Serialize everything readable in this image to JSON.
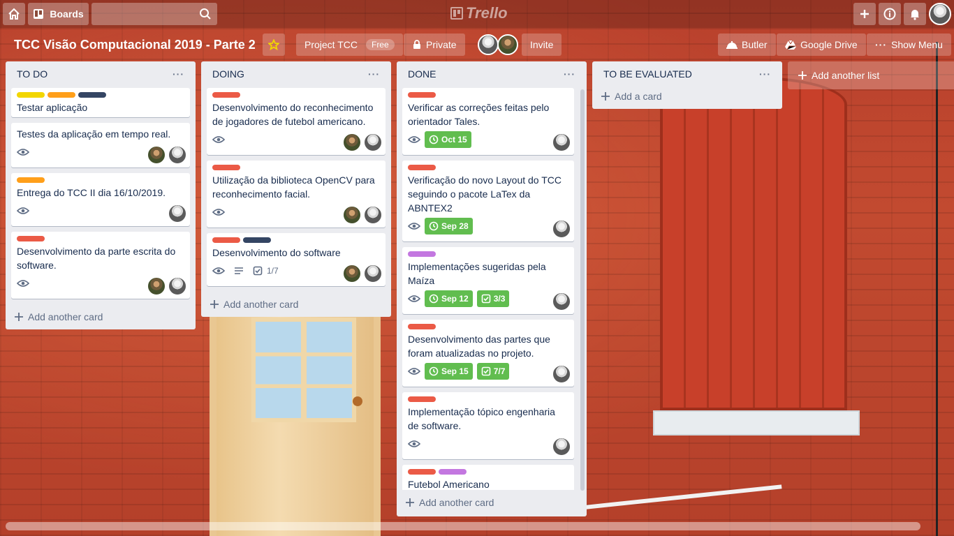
{
  "header": {
    "boards_label": "Boards",
    "search_placeholder": "",
    "logo_text": "Trello"
  },
  "board": {
    "title": "TCC Visão Computacional 2019 - Parte 2",
    "team_label": "Project TCC",
    "team_badge": "Free",
    "visibility_label": "Private",
    "invite_label": "Invite",
    "butler_label": "Butler",
    "gdrive_label": "Google Drive",
    "menu_label": "Show Menu",
    "add_list_label": "Add another list"
  },
  "lists": [
    {
      "title": "TO DO",
      "add_card": "Add another card",
      "cards": [
        {
          "title": "Testar aplicação"
        },
        {
          "title": "Testes da aplicação em tempo real."
        },
        {
          "title": "Entrega do TCC II dia 16/10/2019."
        },
        {
          "title": "Desenvolvimento da parte escrita do software."
        }
      ]
    },
    {
      "title": "DOING",
      "add_card": "Add another card",
      "cards": [
        {
          "title": "Desenvolvimento do reconhecimento de jogadores de futebol americano."
        },
        {
          "title": "Utilização da biblioteca OpenCV para reconhecimento facial."
        },
        {
          "title": "Desenvolvimento do software",
          "checklist": "1/7"
        }
      ]
    },
    {
      "title": "DONE",
      "add_card": "Add another card",
      "cards": [
        {
          "title": "Verificar as correções feitas pelo orientador Tales.",
          "due": "Oct 15"
        },
        {
          "title": "Verificação do novo Layout do TCC seguindo o pacote LaTex da ABNTEX2",
          "due": "Sep 28"
        },
        {
          "title": "Implementações sugeridas pela Maíza",
          "due": "Sep 12",
          "checklist": "3/3"
        },
        {
          "title": "Desenvolvimento das partes que foram atualizadas no projeto.",
          "due": "Sep 15",
          "checklist": "7/7"
        },
        {
          "title": "Implementação tópico engenharia de software."
        },
        {
          "title": "Futebol Americano"
        }
      ]
    },
    {
      "title": "TO BE EVALUATED",
      "add_card": "Add a card",
      "cards": []
    }
  ],
  "colors": {
    "label_red": "#eb5a46",
    "label_yellow": "#f2d600",
    "label_orange": "#ff9f1a",
    "label_navy": "#344563",
    "label_purple": "#c377e0",
    "due_complete": "#61bd4f"
  }
}
